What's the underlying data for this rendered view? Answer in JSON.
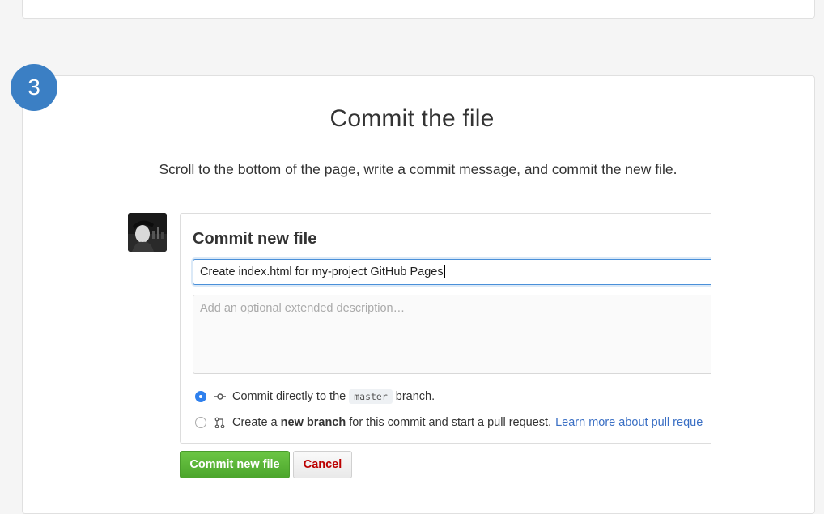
{
  "step": {
    "number": "3",
    "title": "Commit the file",
    "description": "Scroll to the bottom of the page, write a commit message, and commit the new file."
  },
  "commit_form": {
    "heading": "Commit new file",
    "summary_value": "Create index.html for my-project GitHub Pages",
    "description_placeholder": "Add an optional extended description…",
    "option_direct": {
      "prefix": "Commit directly to the",
      "branch": "master",
      "suffix": "branch.",
      "icon": "git-commit-icon",
      "selected": true
    },
    "option_new_branch": {
      "prefix": "Create a",
      "bold": "new branch",
      "suffix": "for this commit and start a pull request.",
      "link": "Learn more about pull reque",
      "icon": "git-pull-request-icon",
      "selected": false
    },
    "commit_button": "Commit new file",
    "cancel_button": "Cancel"
  },
  "colors": {
    "badge": "#3b7fc4",
    "primary_button": "#5cb83a",
    "cancel_text": "#bb0000",
    "link": "#3a6fc4"
  }
}
